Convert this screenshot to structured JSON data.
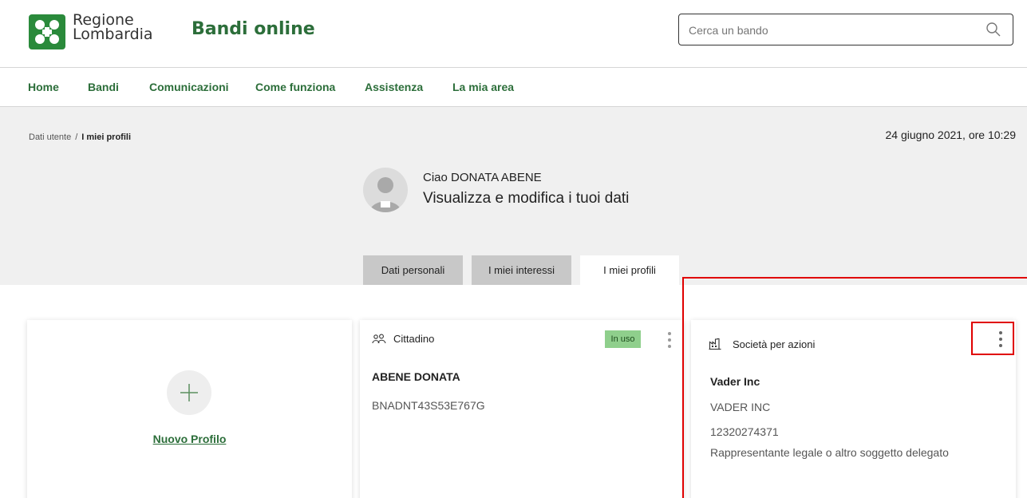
{
  "header": {
    "logo_line1": "Regione",
    "logo_line2": "Lombardia",
    "app_title": "Bandi online",
    "search_placeholder": "Cerca un bando"
  },
  "nav": {
    "items": [
      {
        "label": "Home"
      },
      {
        "label": "Bandi"
      },
      {
        "label": "Comunicazioni"
      },
      {
        "label": "Come funziona"
      },
      {
        "label": "Assistenza"
      },
      {
        "label": "La mia area"
      }
    ]
  },
  "breadcrumb": {
    "parent": "Dati utente",
    "separator": "/",
    "current": "I miei profili"
  },
  "datetime": "24 giugno 2021, ore 10:29",
  "user": {
    "greeting": "Ciao DONATA ABENE",
    "subtitle": "Visualizza e modifica i tuoi dati"
  },
  "tabs": [
    {
      "label": "Dati personali",
      "active": false
    },
    {
      "label": "I miei interessi",
      "active": false
    },
    {
      "label": "I miei profili",
      "active": true
    }
  ],
  "cards": {
    "new_profile": {
      "label": "Nuovo Profilo",
      "icon": "plus-icon"
    },
    "cittadino": {
      "type": "Cittadino",
      "badge": "In uso",
      "name": "ABENE DONATA",
      "code": "BNADNT43S53E767G",
      "icon": "people-icon"
    },
    "societa": {
      "type": "Società per azioni",
      "name": "Vader Inc",
      "company": "VADER INC",
      "vat": "12320274371",
      "role": "Rappresentante legale o altro soggetto delegato",
      "icon": "factory-icon"
    }
  },
  "colors": {
    "brand_green": "#2c6e3a",
    "logo_green": "#2a8a3b",
    "badge_green": "#8fcf8c",
    "highlight_red": "#e00000",
    "gray_bg": "#f0f0f0"
  }
}
